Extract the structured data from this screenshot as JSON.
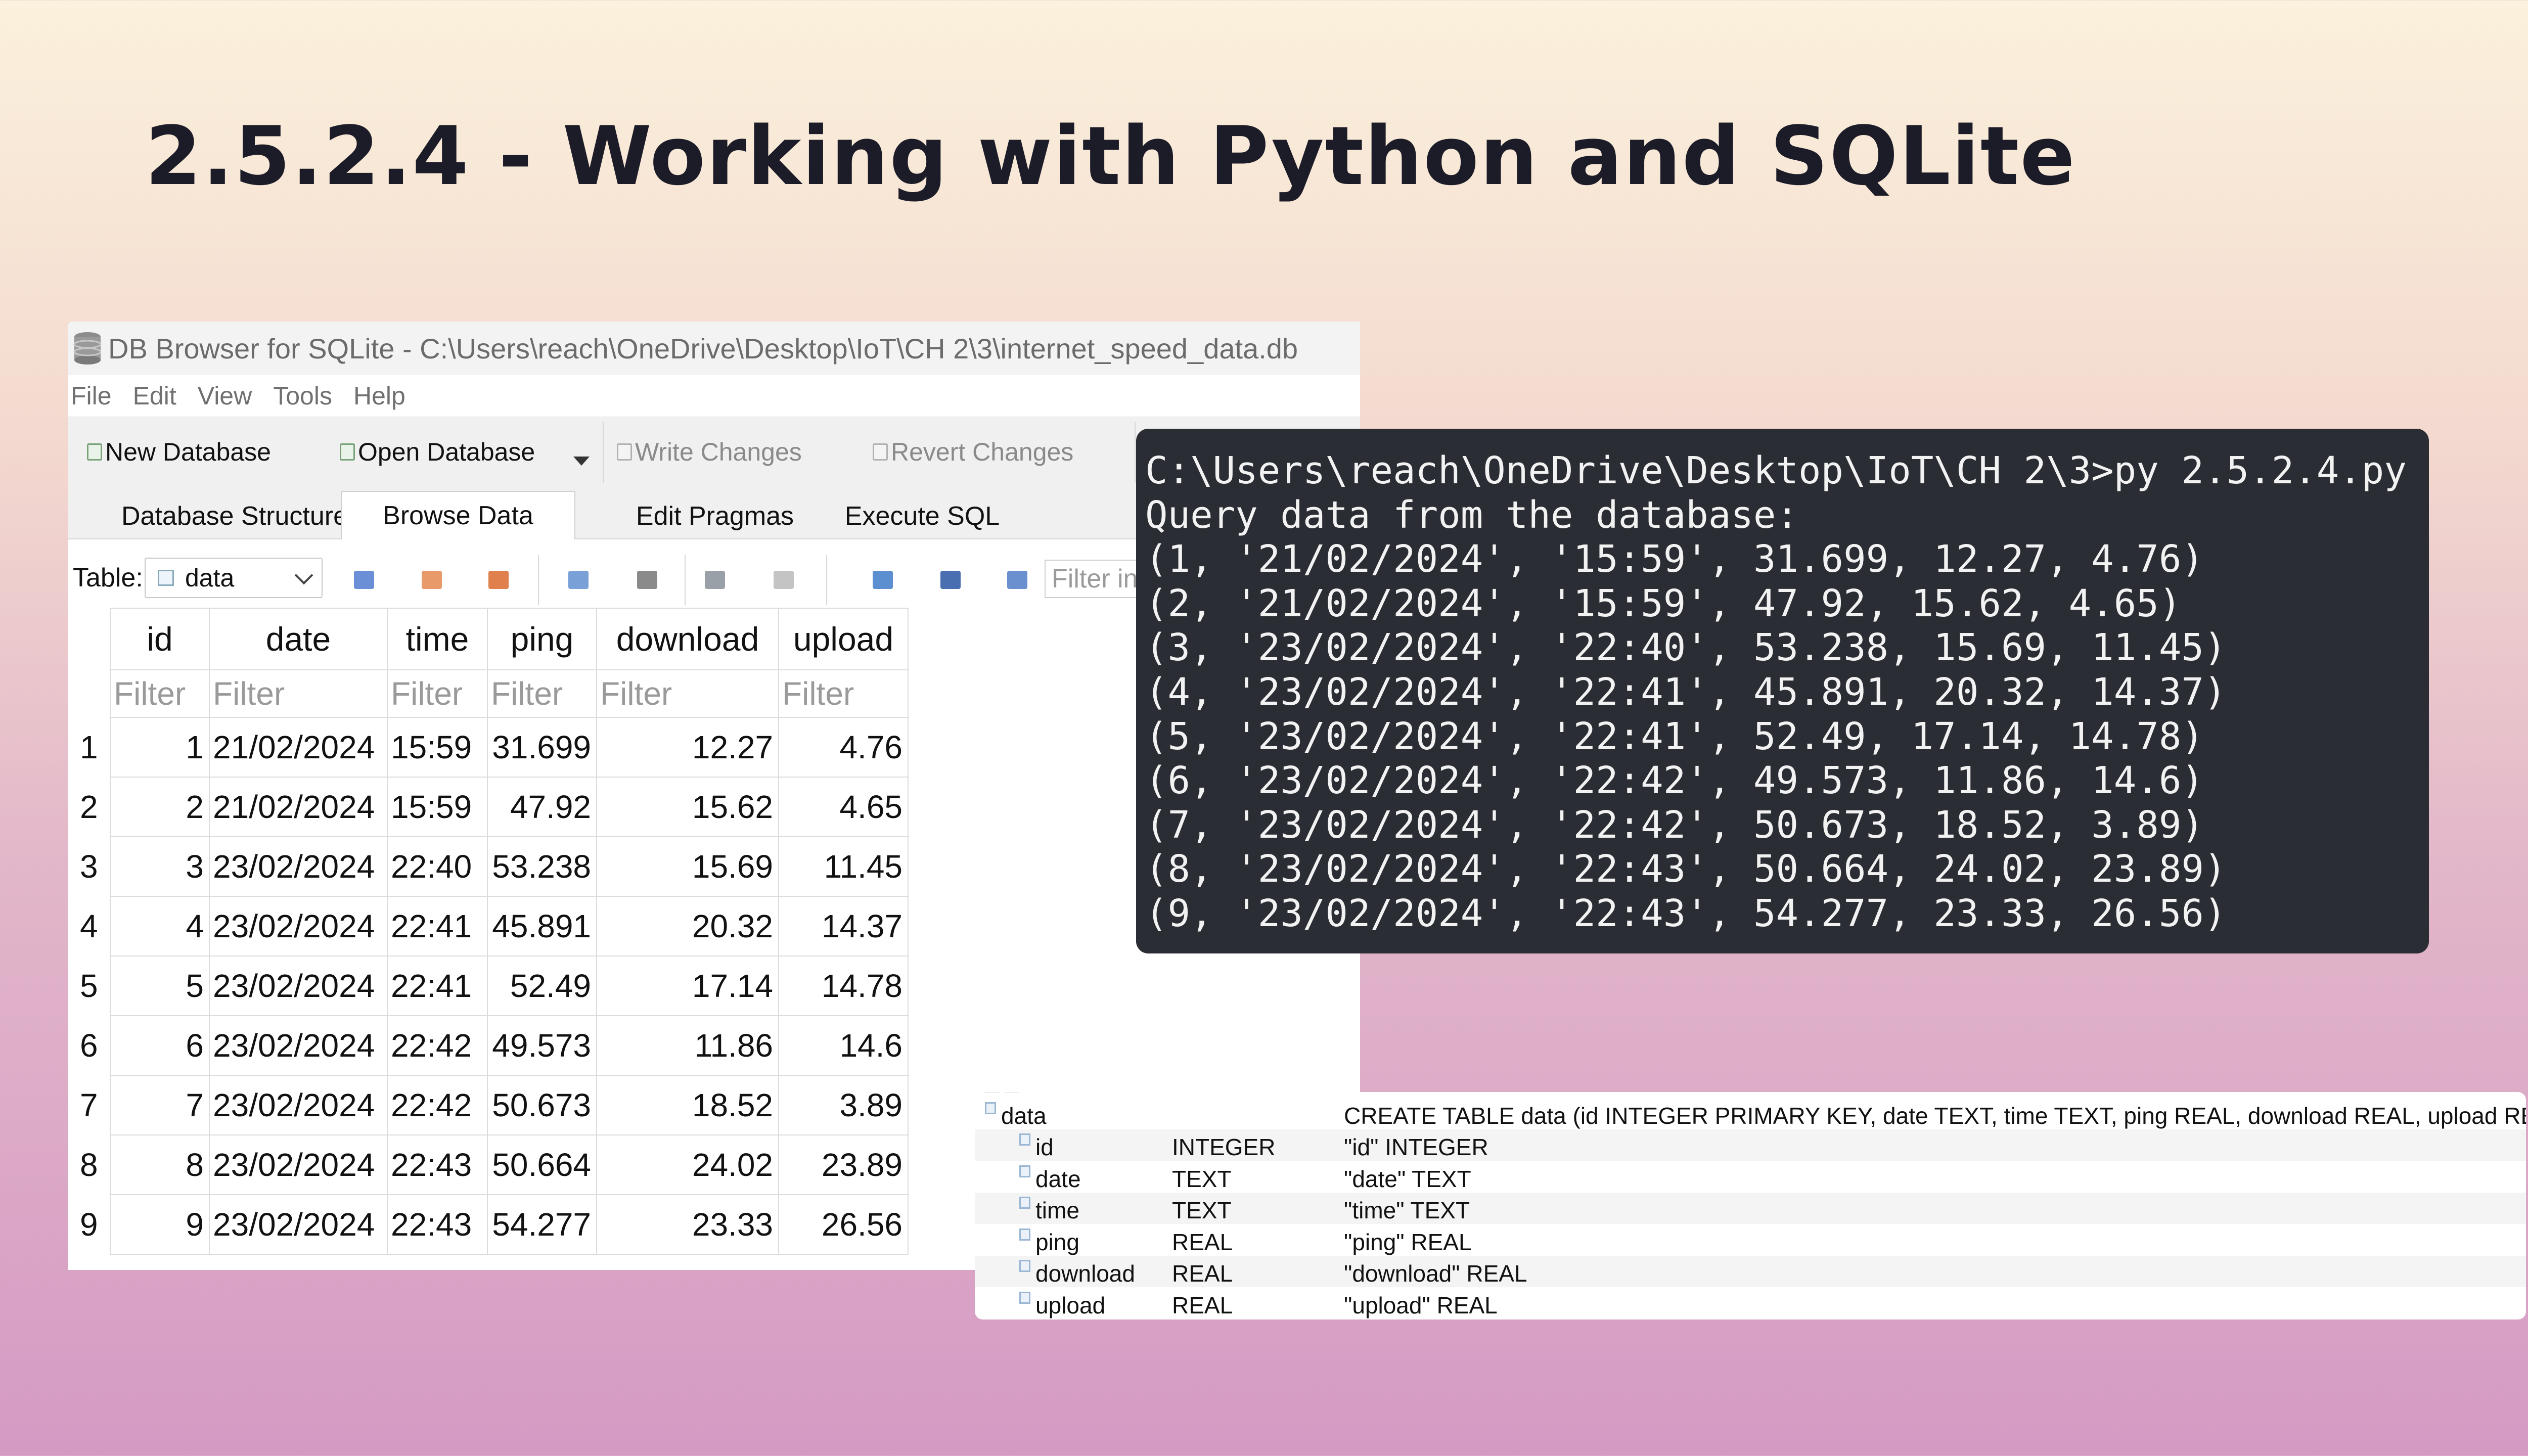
{
  "slide": {
    "title": "2.5.2.4 - Working with Python and SQLite"
  },
  "window": {
    "title": "DB Browser for SQLite - C:\\Users\\reach\\OneDrive\\Desktop\\IoT\\CH 2\\3\\internet_speed_data.db",
    "menu": [
      "File",
      "Edit",
      "View",
      "Tools",
      "Help"
    ],
    "toolbar": {
      "new_database": "New Database",
      "open_database": "Open Database",
      "write_changes": "Write Changes",
      "revert_changes": "Revert Changes"
    },
    "tabs": [
      "Database Structure",
      "Browse Data",
      "Edit Pragmas",
      "Execute SQL"
    ],
    "active_tab": "Browse Data",
    "table_label": "Table:",
    "table_selected": "data",
    "filter_placeholder": "Filter in"
  },
  "grid": {
    "columns": [
      "id",
      "date",
      "time",
      "ping",
      "download",
      "upload"
    ],
    "filter_placeholder": "Filter",
    "rows": [
      {
        "n": "1",
        "id": "1",
        "date": "21/02/2024",
        "time": "15:59",
        "ping": "31.699",
        "download": "12.27",
        "upload": "4.76"
      },
      {
        "n": "2",
        "id": "2",
        "date": "21/02/2024",
        "time": "15:59",
        "ping": "47.92",
        "download": "15.62",
        "upload": "4.65"
      },
      {
        "n": "3",
        "id": "3",
        "date": "23/02/2024",
        "time": "22:40",
        "ping": "53.238",
        "download": "15.69",
        "upload": "11.45"
      },
      {
        "n": "4",
        "id": "4",
        "date": "23/02/2024",
        "time": "22:41",
        "ping": "45.891",
        "download": "20.32",
        "upload": "14.37"
      },
      {
        "n": "5",
        "id": "5",
        "date": "23/02/2024",
        "time": "22:41",
        "ping": "52.49",
        "download": "17.14",
        "upload": "14.78"
      },
      {
        "n": "6",
        "id": "6",
        "date": "23/02/2024",
        "time": "22:42",
        "ping": "49.573",
        "download": "11.86",
        "upload": "14.6"
      },
      {
        "n": "7",
        "id": "7",
        "date": "23/02/2024",
        "time": "22:42",
        "ping": "50.673",
        "download": "18.52",
        "upload": "3.89"
      },
      {
        "n": "8",
        "id": "8",
        "date": "23/02/2024",
        "time": "22:43",
        "ping": "50.664",
        "download": "24.02",
        "upload": "23.89"
      },
      {
        "n": "9",
        "id": "9",
        "date": "23/02/2024",
        "time": "22:43",
        "ping": "54.277",
        "download": "23.33",
        "upload": "26.56"
      }
    ]
  },
  "terminal": {
    "lines": [
      "C:\\Users\\reach\\OneDrive\\Desktop\\IoT\\CH 2\\3>py 2.5.2.4.py",
      "Query data from the database:",
      "(1, '21/02/2024', '15:59', 31.699, 12.27, 4.76)",
      "(2, '21/02/2024', '15:59', 47.92, 15.62, 4.65)",
      "(3, '23/02/2024', '22:40', 53.238, 15.69, 11.45)",
      "(4, '23/02/2024', '22:41', 45.891, 20.32, 14.37)",
      "(5, '23/02/2024', '22:41', 52.49, 17.14, 14.78)",
      "(6, '23/02/2024', '22:42', 49.573, 11.86, 14.6)",
      "(7, '23/02/2024', '22:42', 50.673, 18.52, 3.89)",
      "(8, '23/02/2024', '22:43', 50.664, 24.02, 23.89)",
      "(9, '23/02/2024', '22:43', 54.277, 23.33, 26.56)"
    ]
  },
  "schema": {
    "table_name": "data",
    "create_statement": "CREATE TABLE data (id INTEGER PRIMARY KEY, date TEXT, time TEXT, ping REAL, download REAL, upload REAL)",
    "fields": [
      {
        "name": "id",
        "type": "INTEGER",
        "schema": "\"id\" INTEGER"
      },
      {
        "name": "date",
        "type": "TEXT",
        "schema": "\"date\" TEXT"
      },
      {
        "name": "time",
        "type": "TEXT",
        "schema": "\"time\" TEXT"
      },
      {
        "name": "ping",
        "type": "REAL",
        "schema": "\"ping\" REAL"
      },
      {
        "name": "download",
        "type": "REAL",
        "schema": "\"download\" REAL"
      },
      {
        "name": "upload",
        "type": "REAL",
        "schema": "\"upload\" REAL"
      }
    ]
  },
  "icons": {
    "app": "database-icon",
    "tb_new": "new-database-icon",
    "tb_open": "open-database-icon",
    "tb_write": "write-changes-icon",
    "tb_revert": "revert-changes-icon"
  }
}
